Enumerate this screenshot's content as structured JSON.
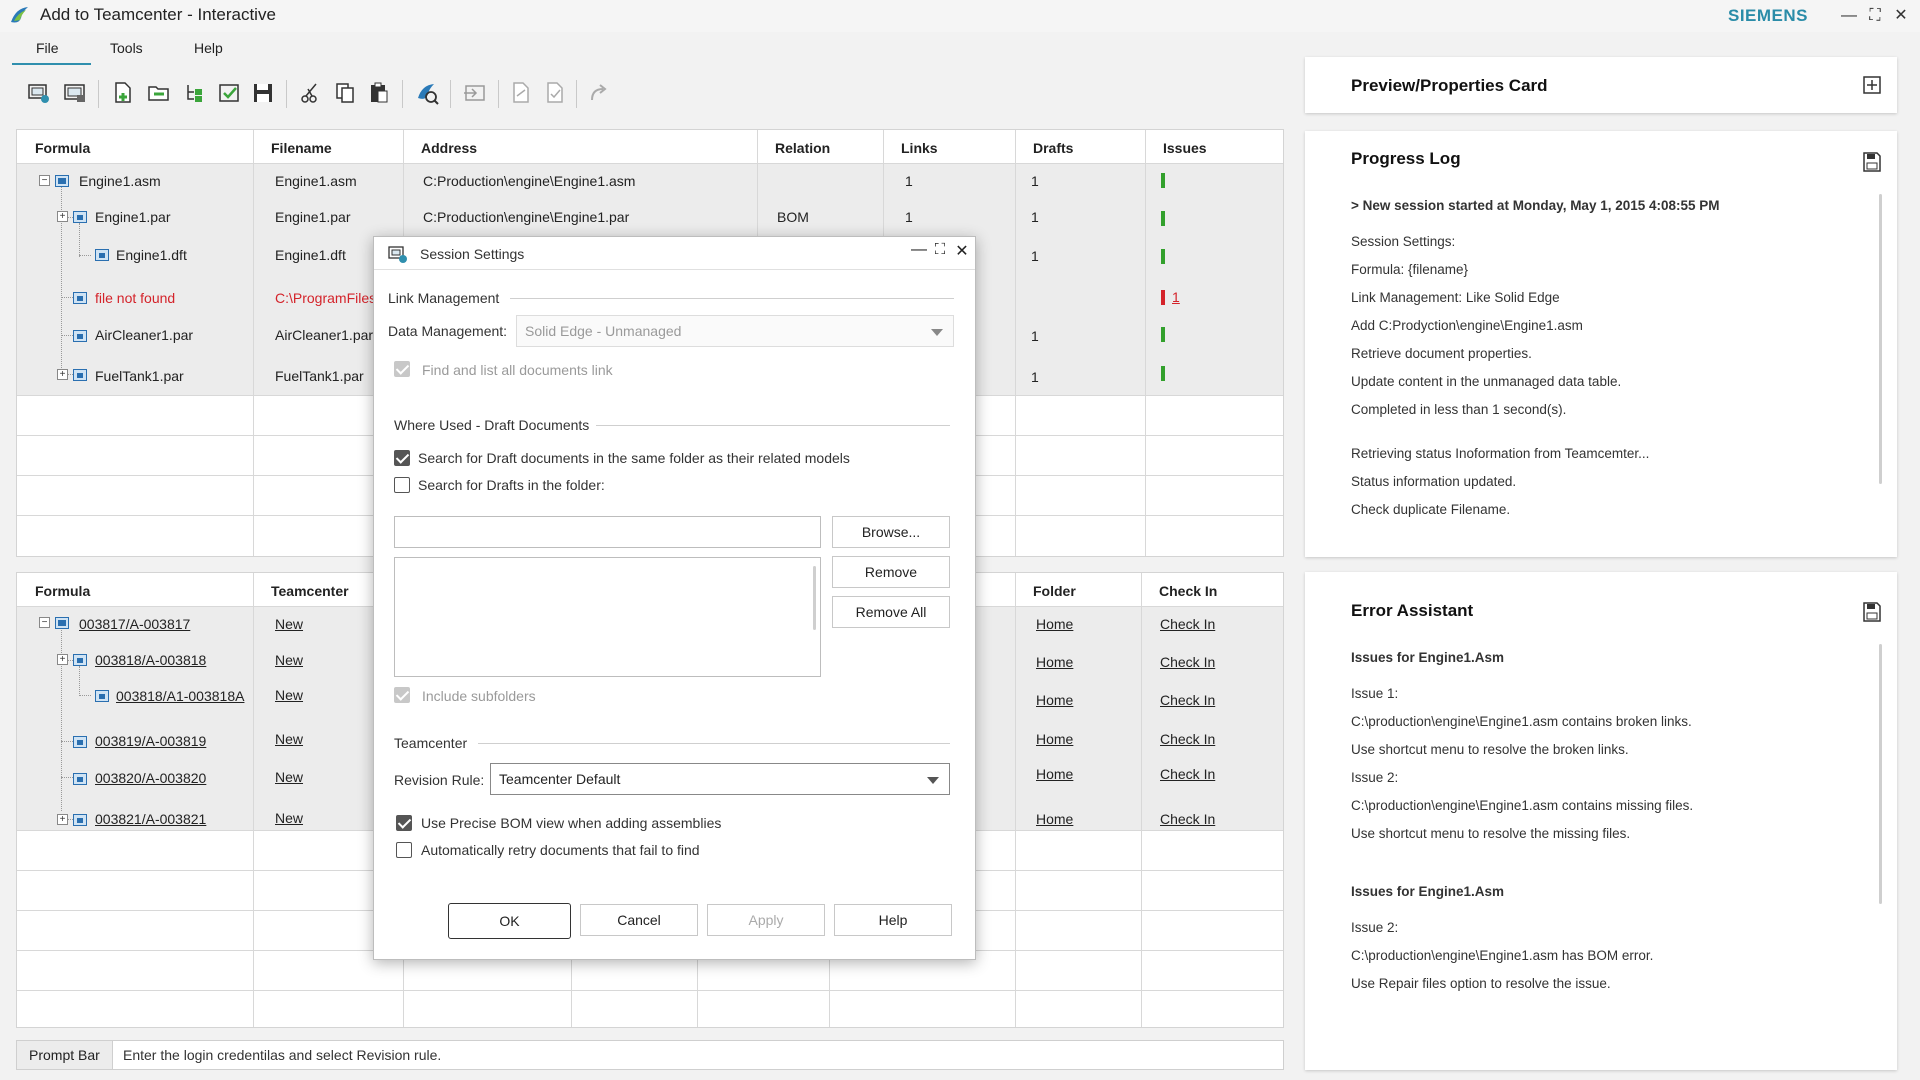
{
  "window": {
    "title": "Add to Teamcenter - Interactive",
    "brand": "SIEMENS",
    "minimize": "—",
    "maximize": "⛶",
    "close": "✕"
  },
  "menu": {
    "file": "File",
    "tools": "Tools",
    "help": "Help"
  },
  "toolbar": {
    "icons": [
      "open-session-icon",
      "save-session-icon",
      "add-file-icon",
      "add-folder-icon",
      "add-tree-icon",
      "check-icon",
      "save-icon",
      "cut-icon",
      "copy-icon",
      "paste-icon",
      "teamcenter-search-icon",
      "import-icon",
      "check-out-icon",
      "check-in-icon",
      "redo-icon"
    ]
  },
  "top_table": {
    "headers": [
      "Formula",
      "Filename",
      "Address",
      "Relation",
      "Links",
      "Drafts",
      "Issues"
    ],
    "rows": [
      {
        "formula": "Engine1.asm",
        "filename": "Engine1.asm",
        "address": "C:Production\\engine\\Engine1.asm",
        "relation": "",
        "links": "1",
        "drafts": "1",
        "issue": "",
        "status": "ok"
      },
      {
        "formula": "Engine1.par",
        "filename": "Engine1.par",
        "address": "C:Production\\engine\\Engine1.par",
        "relation": "BOM",
        "links": "1",
        "drafts": "1",
        "issue": "",
        "status": "ok"
      },
      {
        "formula": "Engine1.dft",
        "filename": "Engine1.dft",
        "address": "",
        "relation": "",
        "links": "",
        "drafts": "1",
        "issue": "",
        "status": "ok"
      },
      {
        "formula": "file not found",
        "filename": "C:\\ProgramFiles",
        "address": "",
        "relation": "",
        "links": "",
        "drafts": "",
        "issue": "1",
        "status": "error"
      },
      {
        "formula": "AirCleaner1.par",
        "filename": "AirCleaner1.par",
        "address": "",
        "relation": "",
        "links": "",
        "drafts": "1",
        "issue": "",
        "status": "ok"
      },
      {
        "formula": "FuelTank1.par",
        "filename": "FuelTank1.par",
        "address": "",
        "relation": "",
        "links": "",
        "drafts": "1",
        "issue": "",
        "status": "ok"
      }
    ]
  },
  "bottom_table": {
    "headers": [
      "Formula",
      "Teamcenter",
      "Folder",
      "Check In"
    ],
    "rows": [
      {
        "formula": "003817/A-003817",
        "teamcenter": "New",
        "folder": "Home",
        "checkin": "Check In"
      },
      {
        "formula": "003818/A-003818",
        "teamcenter": "New",
        "folder": "Home",
        "checkin": "Check In"
      },
      {
        "formula": "003818/A1-003818A",
        "teamcenter": "New",
        "folder": "Home",
        "checkin": "Check In"
      },
      {
        "formula": "003819/A-003819",
        "teamcenter": "New",
        "folder": "Home",
        "checkin": "Check In"
      },
      {
        "formula": "003820/A-003820",
        "teamcenter": "New",
        "folder": "Home",
        "checkin": "Check In"
      },
      {
        "formula": "003821/A-003821",
        "teamcenter": "New",
        "folder": "Home",
        "checkin": "Check In"
      }
    ]
  },
  "prompt": {
    "label": "Prompt Bar",
    "text": "Enter the login credentilas and select Revision rule."
  },
  "preview": {
    "title": "Preview/Properties Card"
  },
  "progress": {
    "title": "Progress Log",
    "lines": [
      "> New session started at Monday, May 1, 2015 4:08:55 PM",
      "Session Settings:",
      "Formula:  {filename}",
      "Link Management: Like Solid Edge",
      "Add C:Prodyction\\engine\\Engine1.asm",
      "Retrieve document properties.",
      "Update content in the unmanaged data table.",
      "Completed in less than 1 second(s).",
      "Retrieving status Inoformation from Teamcemter...",
      "Status information updated.",
      "Check duplicate Filename."
    ]
  },
  "errors": {
    "title": "Error Assistant",
    "lines": [
      "Issues for Engine1.Asm",
      "Issue 1:",
      "C:\\production\\engine\\Engine1.asm contains broken links.",
      "Use shortcut menu to resolve the broken links.",
      "Issue 2:",
      "C:\\production\\engine\\Engine1.asm contains missing files.",
      "Use shortcut menu to resolve the missing files.",
      "Issues for Engine1.Asm",
      "Issue 2:",
      "C:\\production\\engine\\Engine1.asm has BOM error.",
      "Use Repair files option to resolve the issue."
    ]
  },
  "dialog": {
    "title": "Session Settings",
    "link_management": "Link Management",
    "data_management_label": "Data Management:",
    "data_management_value": "Solid Edge - Unmanaged",
    "find_all_links": "Find and list all documents link",
    "where_used": "Where Used - Draft Documents",
    "search_same_folder": "Search for Draft documents in the same folder as their related models",
    "search_in_folder": "Search for Drafts in the folder:",
    "folder_path": "",
    "browse": "Browse...",
    "remove": "Remove",
    "remove_all": "Remove All",
    "include_subfolders": "Include subfolders",
    "teamcenter": "Teamcenter",
    "revision_rule_label": "Revision Rule:",
    "revision_rule_value": "Teamcenter Default",
    "precise_bom": "Use Precise BOM view when adding assemblies",
    "auto_retry": "Automatically retry documents that fail to find",
    "ok": "OK",
    "cancel": "Cancel",
    "apply": "Apply",
    "help": "Help",
    "checks": {
      "find_all_links": true,
      "search_same_folder": true,
      "search_in_folder": false,
      "include_subfolders": true,
      "precise_bom": true,
      "auto_retry": false
    }
  },
  "colors": {
    "accent": "#2f8fae",
    "brand": "#2a8ca8",
    "ok": "#32a02c",
    "error": "#d4232a"
  }
}
